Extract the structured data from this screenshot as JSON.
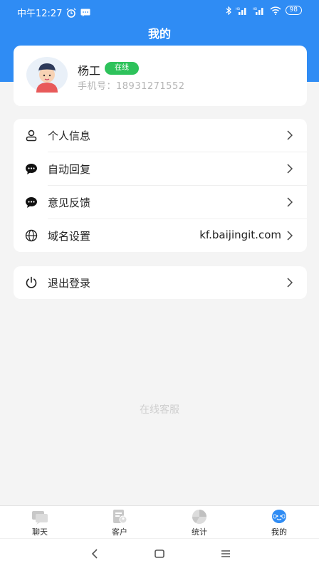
{
  "status_bar": {
    "time": "中午12:27",
    "battery": "98"
  },
  "header": {
    "title": "我的"
  },
  "profile": {
    "name": "杨工",
    "status": "在线",
    "phone_label": "手机号：",
    "phone": "18931271552"
  },
  "menu": [
    {
      "label": "个人信息",
      "icon": "person-icon"
    },
    {
      "label": "自动回复",
      "icon": "chat-bubble-icon"
    },
    {
      "label": "意见反馈",
      "icon": "chat-bubble-icon"
    },
    {
      "label": "域名设置",
      "icon": "globe-icon",
      "value": "kf.baijingit.com"
    }
  ],
  "logout": {
    "label": "退出登录",
    "icon": "power-icon"
  },
  "watermark": "在线客服",
  "tabs": [
    {
      "label": "聊天",
      "icon": "chat-tab-icon",
      "active": false
    },
    {
      "label": "客户",
      "icon": "customer-tab-icon",
      "active": false
    },
    {
      "label": "统计",
      "icon": "stats-tab-icon",
      "active": false
    },
    {
      "label": "我的",
      "icon": "me-tab-icon",
      "active": true
    }
  ],
  "colors": {
    "primary": "#2f8cf4",
    "online": "#2ec25b",
    "tab_inactive": "#c8c8c8"
  }
}
